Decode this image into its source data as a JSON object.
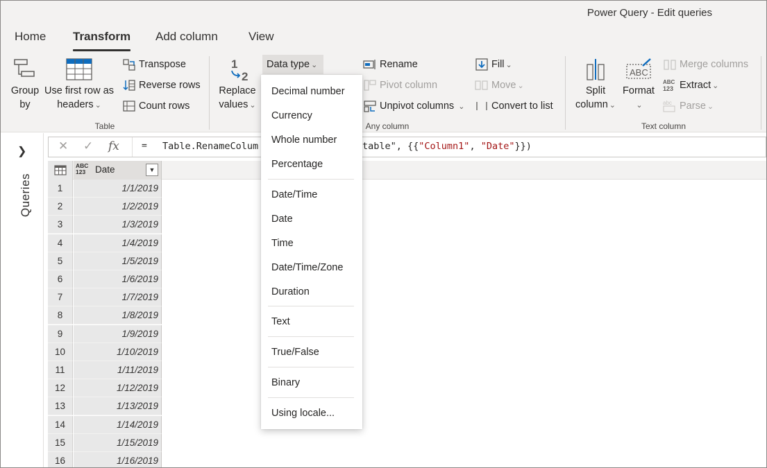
{
  "window": {
    "title": "Power Query - Edit queries"
  },
  "tabs": [
    {
      "label": "Home"
    },
    {
      "label": "Transform"
    },
    {
      "label": "Add column"
    },
    {
      "label": "View"
    }
  ],
  "ribbon": {
    "table_group": {
      "label": "Table",
      "group_by": {
        "line1": "Group",
        "line2": "by"
      },
      "use_first_row": {
        "line1": "Use first row as",
        "line2": "headers"
      },
      "transpose": "Transpose",
      "reverse_rows": "Reverse rows",
      "count_rows": "Count rows"
    },
    "any_column_group": {
      "label": "Any column",
      "replace_values": {
        "line1": "Replace",
        "line2": "values"
      },
      "data_type": "Data type",
      "rename": "Rename",
      "pivot_column": "Pivot column",
      "unpivot_columns": "Unpivot columns",
      "fill": "Fill",
      "move": "Move",
      "convert_to_list": "Convert to list"
    },
    "text_column_group": {
      "label": "Text column",
      "split_column": {
        "line1": "Split",
        "line2": "column"
      },
      "format": {
        "line1": "Format"
      },
      "merge_columns": "Merge columns",
      "extract": "Extract",
      "parse": "Parse"
    }
  },
  "queries_pane": {
    "label": "Queries"
  },
  "formula_bar": {
    "equals": "=",
    "part1": "Table.RenameColum",
    "part2": "table\", {{",
    "str1": "\"Column1\"",
    "comma": ", ",
    "str2": "\"Date\"",
    "close": "}})"
  },
  "grid": {
    "column": {
      "type_line1": "ABC",
      "type_line2": "123",
      "name": "Date"
    },
    "rows": [
      {
        "n": "1",
        "v": "1/1/2019"
      },
      {
        "n": "2",
        "v": "1/2/2019"
      },
      {
        "n": "3",
        "v": "1/3/2019"
      },
      {
        "n": "4",
        "v": "1/4/2019"
      },
      {
        "n": "5",
        "v": "1/5/2019"
      },
      {
        "n": "6",
        "v": "1/6/2019"
      },
      {
        "n": "7",
        "v": "1/7/2019"
      },
      {
        "n": "8",
        "v": "1/8/2019"
      },
      {
        "n": "9",
        "v": "1/9/2019"
      },
      {
        "n": "10",
        "v": "1/10/2019"
      },
      {
        "n": "11",
        "v": "1/11/2019"
      },
      {
        "n": "12",
        "v": "1/12/2019"
      },
      {
        "n": "13",
        "v": "1/13/2019"
      },
      {
        "n": "14",
        "v": "1/14/2019"
      },
      {
        "n": "15",
        "v": "1/15/2019"
      },
      {
        "n": "16",
        "v": "1/16/2019"
      }
    ]
  },
  "data_type_menu": {
    "items": [
      "Decimal number",
      "Currency",
      "Whole number",
      "Percentage",
      "Date/Time",
      "Date",
      "Time",
      "Date/Time/Zone",
      "Duration",
      "Text",
      "True/False",
      "Binary",
      "Using locale..."
    ]
  }
}
